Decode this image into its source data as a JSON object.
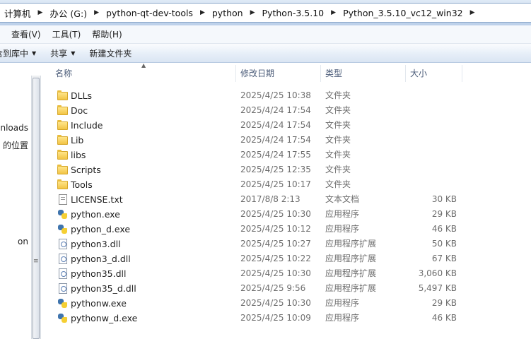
{
  "address": {
    "crumbs": [
      "计算机",
      "办公 (G:)",
      "python-qt-dev-tools",
      "python",
      "Python-3.5.10",
      "Python_3.5.10_vc12_win32"
    ]
  },
  "menu": [
    "查看(V)",
    "工具(T)",
    "帮助(H)"
  ],
  "toolbar": {
    "include_library": "含到库中",
    "share": "共享",
    "new_folder": "新建文件夹"
  },
  "nav": [
    "wnloads",
    "的位置",
    "on"
  ],
  "columns": {
    "name": "名称",
    "modified": "修改日期",
    "type": "类型",
    "size": "大小"
  },
  "files": [
    {
      "name": "DLLs",
      "date": "2025/4/25 10:38",
      "type": "文件夹",
      "size": "",
      "icon": "folder-icon"
    },
    {
      "name": "Doc",
      "date": "2025/4/24 17:54",
      "type": "文件夹",
      "size": "",
      "icon": "folder-icon"
    },
    {
      "name": "Include",
      "date": "2025/4/24 17:54",
      "type": "文件夹",
      "size": "",
      "icon": "folder-icon"
    },
    {
      "name": "Lib",
      "date": "2025/4/24 17:54",
      "type": "文件夹",
      "size": "",
      "icon": "folder-icon"
    },
    {
      "name": "libs",
      "date": "2025/4/24 17:55",
      "type": "文件夹",
      "size": "",
      "icon": "folder-icon"
    },
    {
      "name": "Scripts",
      "date": "2025/4/25 12:35",
      "type": "文件夹",
      "size": "",
      "icon": "folder-icon"
    },
    {
      "name": "Tools",
      "date": "2025/4/25 10:17",
      "type": "文件夹",
      "size": "",
      "icon": "folder-icon"
    },
    {
      "name": "LICENSE.txt",
      "date": "2017/8/8 2:13",
      "type": "文本文档",
      "size": "30 KB",
      "icon": "text-file-icon"
    },
    {
      "name": "python.exe",
      "date": "2025/4/25 10:30",
      "type": "应用程序",
      "size": "29 KB",
      "icon": "python-icon"
    },
    {
      "name": "python_d.exe",
      "date": "2025/4/25 10:12",
      "type": "应用程序",
      "size": "46 KB",
      "icon": "python-icon"
    },
    {
      "name": "python3.dll",
      "date": "2025/4/25 10:27",
      "type": "应用程序扩展",
      "size": "50 KB",
      "icon": "dll-file-icon"
    },
    {
      "name": "python3_d.dll",
      "date": "2025/4/25 10:22",
      "type": "应用程序扩展",
      "size": "67 KB",
      "icon": "dll-file-icon"
    },
    {
      "name": "python35.dll",
      "date": "2025/4/25 10:30",
      "type": "应用程序扩展",
      "size": "3,060 KB",
      "icon": "dll-file-icon"
    },
    {
      "name": "python35_d.dll",
      "date": "2025/4/25 9:56",
      "type": "应用程序扩展",
      "size": "5,497 KB",
      "icon": "dll-file-icon"
    },
    {
      "name": "pythonw.exe",
      "date": "2025/4/25 10:30",
      "type": "应用程序",
      "size": "29 KB",
      "icon": "python-icon"
    },
    {
      "name": "pythonw_d.exe",
      "date": "2025/4/25 10:09",
      "type": "应用程序",
      "size": "46 KB",
      "icon": "python-icon"
    }
  ]
}
